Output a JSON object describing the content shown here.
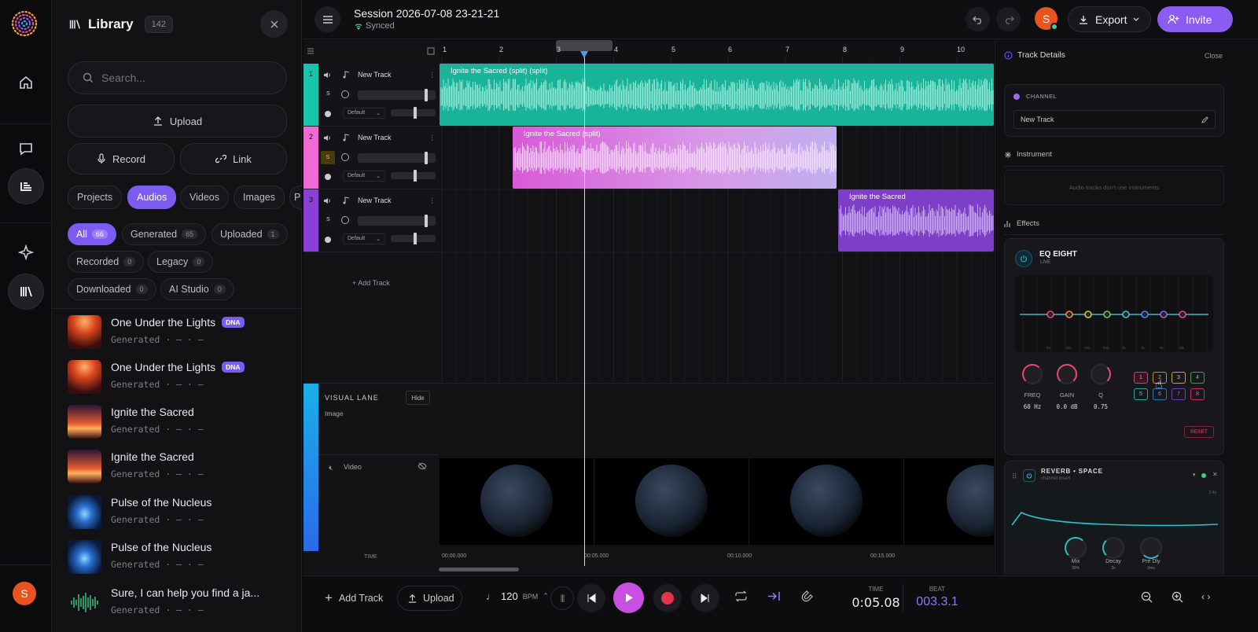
{
  "rail": {
    "avatar": "S"
  },
  "library": {
    "title": "Library",
    "count": "142",
    "search_placeholder": "Search...",
    "upload": "Upload",
    "record": "Record",
    "link": "Link",
    "tabs": [
      "Projects",
      "Audios",
      "Videos",
      "Images",
      "P"
    ],
    "filters": [
      {
        "label": "All",
        "count": "66"
      },
      {
        "label": "Generated",
        "count": "65"
      },
      {
        "label": "Uploaded",
        "count": "1"
      },
      {
        "label": "Recorded",
        "count": "0"
      },
      {
        "label": "Legacy",
        "count": "0"
      },
      {
        "label": "Downloaded",
        "count": "0"
      },
      {
        "label": "AI Studio",
        "count": "0"
      }
    ],
    "items": [
      {
        "title": "One Under the Lights",
        "badge": "DNA",
        "sub": "Generated · — · —"
      },
      {
        "title": "One Under the Lights",
        "badge": "DNA",
        "sub": "Generated · — · —"
      },
      {
        "title": "Ignite the Sacred",
        "badge": "",
        "sub": "Generated · — · —"
      },
      {
        "title": "Ignite the Sacred",
        "badge": "",
        "sub": "Generated · — · —"
      },
      {
        "title": "Pulse of the Nucleus",
        "badge": "",
        "sub": "Generated · — · —"
      },
      {
        "title": "Pulse of the Nucleus",
        "badge": "",
        "sub": "Generated · — · —"
      },
      {
        "title": "Sure, I can help you find a ja...",
        "badge": "",
        "sub": "Generated · — · —"
      }
    ]
  },
  "topbar": {
    "session": "Session 2026-07-08 23-21-21",
    "status": "Synced",
    "avatar": "S",
    "export": "Export",
    "invite": "Invite"
  },
  "tracks": [
    {
      "num": "1",
      "name": "New Track",
      "s": "S",
      "mode": "Default",
      "color": "#17c6a8"
    },
    {
      "num": "2",
      "name": "New Track",
      "s": "S",
      "mode": "Default",
      "color": "#f06ad6"
    },
    {
      "num": "3",
      "name": "New Track",
      "s": "S",
      "mode": "Default",
      "color": "#8a3fd6"
    }
  ],
  "add_track_inline": "+ Add Track",
  "ruler": [
    "1",
    "2",
    "3",
    "4",
    "5",
    "6",
    "7",
    "8",
    "9",
    "10"
  ],
  "clips": [
    {
      "label": "Ignite the Sacred (split) (split)"
    },
    {
      "label": "Ignite the Sacred (split)"
    },
    {
      "label": "Ignite the Sacred"
    }
  ],
  "visual_lane": {
    "title": "VISUAL LANE",
    "hide": "Hide",
    "sub": "Image",
    "video": "Video",
    "time_label": "TIME"
  },
  "time_ruler": [
    "00:00.000",
    "00:05.000",
    "00:10.000",
    "00:15.000"
  ],
  "details": {
    "title": "Track Details",
    "close": "Close",
    "channel_label": "CHANNEL",
    "channel_name": "New Track",
    "instrument": "Instrument",
    "instrument_note": "Audio tracks don't use instruments",
    "effects": "Effects",
    "eq": {
      "name": "EQ EIGHT",
      "live": "LIVE",
      "freq_ticks": [
        "50",
        "100",
        "200",
        "500",
        "1k",
        "2k",
        "5k",
        "10k"
      ],
      "knobs": [
        {
          "label": "FREQ",
          "value": "60 Hz"
        },
        {
          "label": "GAIN",
          "value": "0.0 dB"
        },
        {
          "label": "Q",
          "value": "0.75"
        }
      ],
      "bands": [
        "1",
        "2",
        "3",
        "4",
        "5",
        "6",
        "7",
        "8"
      ],
      "reset": "RESET"
    },
    "reverb": {
      "name": "REVERB • SPACE",
      "sub": "channel insert",
      "db": "2.4s",
      "knobs": [
        {
          "label": "Mix",
          "value": "30%"
        },
        {
          "label": "Decay",
          "value": "2s"
        },
        {
          "label": "Pre Dly",
          "value": "0ms"
        }
      ]
    }
  },
  "transport": {
    "add_track": "Add Track",
    "upload": "Upload",
    "bpm": "120",
    "bpm_unit": "BPM",
    "time_label": "TIME",
    "time": "0:05.08",
    "beat_label": "BEAT",
    "beat": "003.3.1"
  },
  "colors": {
    "accent": "#7c5cf0",
    "play": "#c84fe0",
    "record": "#e5334b",
    "track1": "#17c6a8",
    "track2": "#f06ad6",
    "track3": "#8a3fd6"
  }
}
